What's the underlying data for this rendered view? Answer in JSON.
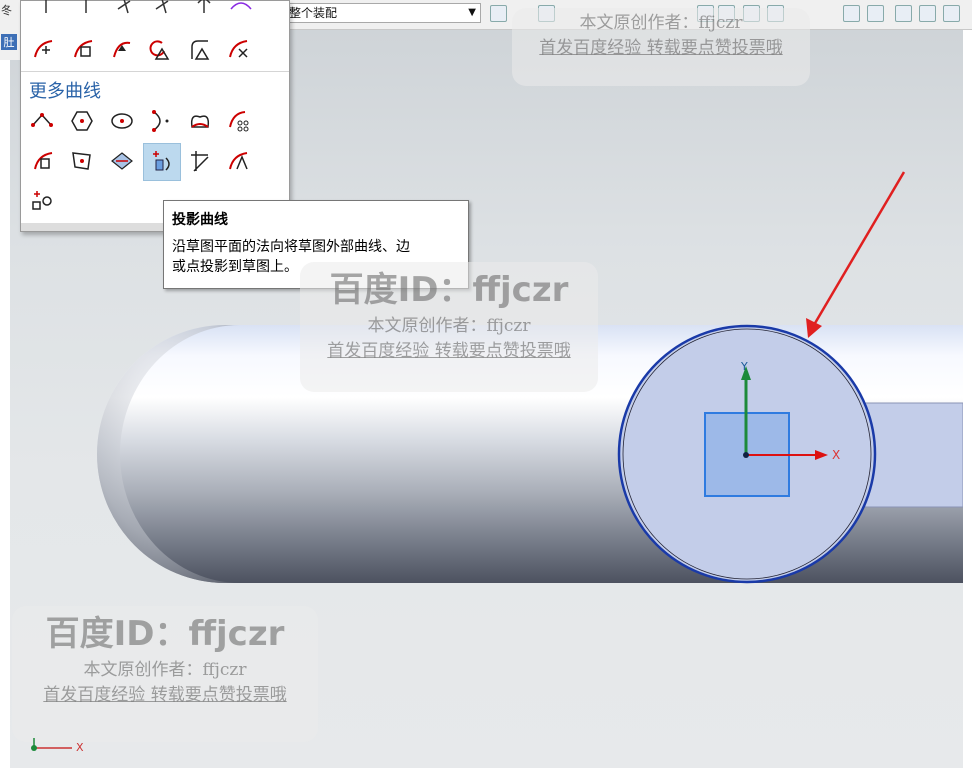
{
  "toolbar": {
    "assembly_value": "整个装配",
    "left_labels": [
      "冬",
      "肚"
    ]
  },
  "panel": {
    "more_curves_label": "更多曲线",
    "row1_icons": [
      "sketch-tool-1-icon",
      "sketch-tool-2-icon",
      "sketch-tool-3-icon",
      "sketch-tool-4-icon",
      "sketch-tool-5-icon"
    ],
    "row2_icons": [
      "move-curve-icon",
      "offset-move-icon",
      "resize-curve-icon",
      "delete-curve-icon",
      "resize-chamfer-icon",
      "trim-curve-icon"
    ],
    "row3_icons": [
      "polygon-vertex-icon",
      "polygon-icon",
      "ellipse-icon",
      "conic-icon",
      "intersect-curve-icon",
      "pattern-curve-icon"
    ],
    "row4_icons": [
      "offset-curve-icon",
      "mirror-curve-icon",
      "derived-curve-icon",
      "project-curve-icon",
      "intersection-point-icon",
      "add-existing-curve-icon"
    ],
    "row5_icons": [
      "point-icon"
    ]
  },
  "tooltip": {
    "title": "投影曲线",
    "body_line1": "沿草图平面的法向将草图外部曲线、边",
    "body_line2": "或点投影到草图上。"
  },
  "viewport": {
    "axis_x": "X",
    "axis_y": "Y",
    "triad_x": "X",
    "highlight_color": "#1a3aa8",
    "arrow_color": "#e02020"
  },
  "watermarks": [
    {
      "big": "百度ID：ffjczr",
      "line1": "本文原创作者：ffjczr",
      "line2": "首发百度经验 转载要点赞投票哦"
    },
    {
      "big": "百度ID：ffjczr",
      "line1": "本文原创作者：ffjczr",
      "line2": "首发百度经验 转载要点赞投票哦"
    },
    {
      "big": "",
      "line1": "本文原创作者：ffjczr",
      "line2": "首发百度经验 转载要点赞投票哦"
    }
  ]
}
